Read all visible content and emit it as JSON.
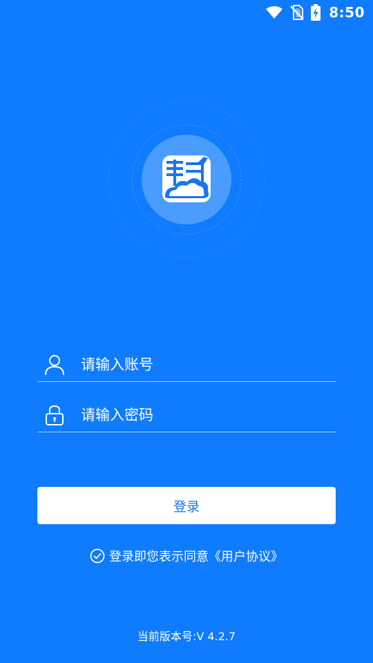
{
  "status_bar": {
    "time": "8:50",
    "icons": [
      "wifi-icon",
      "no-sim-icon",
      "battery-charging-icon"
    ]
  },
  "logo": {
    "icon": "app-logo-icon"
  },
  "form": {
    "account": {
      "icon": "user-icon",
      "placeholder": "请输入账号",
      "value": ""
    },
    "password": {
      "icon": "lock-icon",
      "placeholder": "请输入密码",
      "value": ""
    }
  },
  "login_button": {
    "label": "登录"
  },
  "agreement": {
    "icon": "check-circle-icon",
    "text": "登录即您表示同意",
    "link": "《用户协议》"
  },
  "version": {
    "text": "当前版本号:V 4.2.7"
  },
  "colors": {
    "background": "#0f7bff",
    "button_bg": "#ffffff",
    "button_text": "#1a73f0",
    "logo_circle": "#4a9dff"
  }
}
